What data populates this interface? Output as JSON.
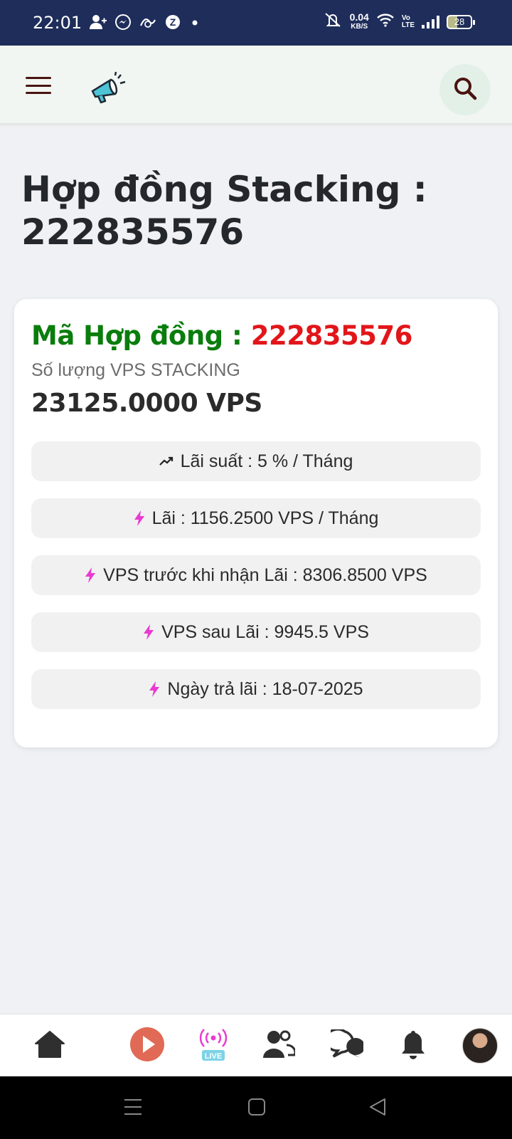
{
  "status_bar": {
    "time": "22:01",
    "net_speed": "0.04",
    "net_unit": "KB/S",
    "volte_top": "Vo",
    "volte_bottom": "LTE",
    "battery": "28"
  },
  "header": {
    "menu_icon": "hamburger-menu-icon",
    "logo_icon": "megaphone-icon",
    "search_icon": "search-icon"
  },
  "page": {
    "title": "Hợp đồng Stacking : 222835576"
  },
  "contract": {
    "code_label": "Mã Hợp đồng : ",
    "code_value": "222835576",
    "quantity_label": "Số lượng VPS STACKING",
    "quantity_value": "23125.0000 VPS",
    "rows": [
      {
        "icon": "trending-up-icon",
        "text": "Lãi suất : 5 % / Tháng"
      },
      {
        "icon": "lightning-icon",
        "text": "Lãi : 1156.2500 VPS / Tháng"
      },
      {
        "icon": "lightning-icon",
        "text": "VPS trước khi nhận Lãi : 8306.8500 VPS"
      },
      {
        "icon": "lightning-icon",
        "text": "VPS sau Lãi : 9945.5 VPS"
      },
      {
        "icon": "lightning-icon",
        "text": "Ngày trả lãi : 18-07-2025"
      }
    ],
    "colors": {
      "label_green": "#0a7d0c",
      "value_red": "#e2161a",
      "lightning_pink": "#e93ad0"
    }
  },
  "bottom_nav": {
    "items": [
      "home-icon",
      "play-icon",
      "live-icon",
      "friends-icon",
      "chat-icon",
      "bell-icon",
      "avatar"
    ],
    "live_badge": "LIVE"
  },
  "system_nav": [
    "recents-icon",
    "home-square-icon",
    "back-triangle-icon"
  ]
}
